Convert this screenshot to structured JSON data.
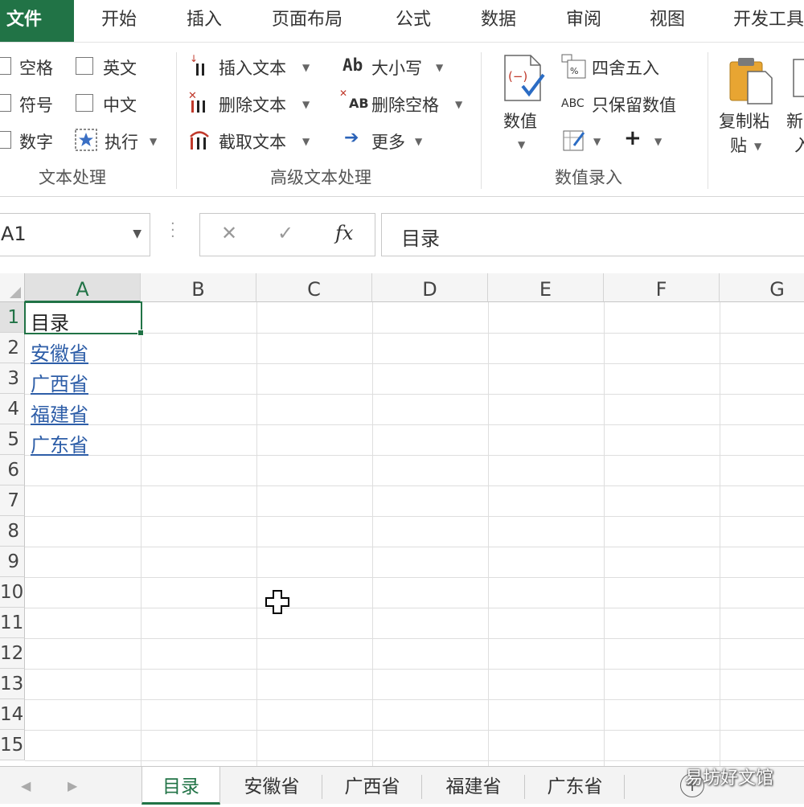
{
  "menu": {
    "tabs": [
      {
        "label": "文件",
        "active": true
      },
      {
        "label": "开始"
      },
      {
        "label": "插入"
      },
      {
        "label": "页面布局"
      },
      {
        "label": "公式"
      },
      {
        "label": "数据"
      },
      {
        "label": "审阅"
      },
      {
        "label": "视图"
      },
      {
        "label": "开发工具"
      }
    ]
  },
  "ribbon": {
    "text_processing": {
      "group_name": "文本处理",
      "space": "空格",
      "symbol": "符号",
      "number": "数字",
      "english": "英文",
      "chinese": "中文",
      "execute": "执行"
    },
    "advanced_text": {
      "group_name": "高级文本处理",
      "insert_text": "插入文本",
      "delete_text": "删除文本",
      "extract_text": "截取文本",
      "case": "大小写",
      "case_icon": "Ab",
      "delete_spaces": "删除空格",
      "delete_spaces_icon": "AB",
      "more": "更多"
    },
    "numeric_entry": {
      "group_name": "数值录入",
      "value": "数值",
      "round": "四舍五入",
      "keep_values": "只保留数值",
      "keep_values_icon": "ABC"
    },
    "clipboard": {
      "copy_paste_line1": "复制粘",
      "copy_paste_line2": "贴",
      "new_line1": "新",
      "new_line2": "入"
    }
  },
  "formula_bar": {
    "name_box": "A1",
    "content": "目录",
    "cancel_glyph": "✕",
    "enter_glyph": "✓",
    "fx_glyph": "fx"
  },
  "grid": {
    "columns": [
      "A",
      "B",
      "C",
      "D",
      "E",
      "F",
      "G"
    ],
    "rows": [
      "1",
      "2",
      "3",
      "4",
      "5",
      "6",
      "7",
      "8",
      "9",
      "10",
      "11",
      "12",
      "13",
      "14",
      "15"
    ],
    "cells": {
      "A1": "目录",
      "A2": "安徽省",
      "A3": "广西省",
      "A4": "福建省",
      "A5": "广东省"
    }
  },
  "sheets": {
    "tabs": [
      "目录",
      "安徽省",
      "广西省",
      "福建省",
      "广东省"
    ],
    "active": "目录"
  },
  "watermark": "易坊好文馆",
  "colors": {
    "accent": "#217346",
    "link": "#2e5ea8"
  }
}
